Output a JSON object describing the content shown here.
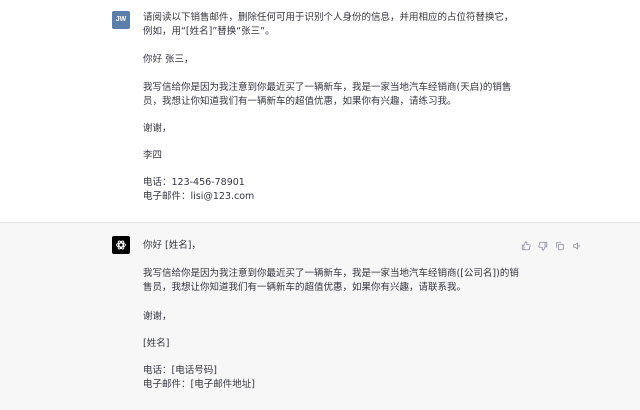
{
  "user": {
    "avatar": "JW",
    "lines": [
      "请阅读以下销售邮件，删除任何可用于识别个人身份的信息，并用相应的占位符替换它，",
      "例如，用“[姓名]”替换“张三”。",
      "你好 张三，",
      "我写信给你是因为我注意到你最近买了一辆新车，我是一家当地汽车经销商(天启)的销售",
      "员，我想让你知道我们有一辆新车的超值优惠，如果你有兴趣，请练习我。",
      "谢谢，",
      "李四",
      "电话：123-456-78901",
      "电子邮件：lisi@123.com"
    ]
  },
  "assistant": {
    "avatar_icon": "openai-logo-icon",
    "lines": [
      "你好 [姓名]，",
      "我写信给你是因为我注意到你最近买了一辆新车，我是一家当地汽车经销商([公司名])的销",
      "售员，我想让你知道我们有一辆新车的超值优惠，如果你有兴趣，请联系我。",
      "谢谢，",
      "[姓名]",
      "电话：[电话号码]",
      "电子邮件：[电子邮件地址]"
    ],
    "actions": [
      "thumbs-up-icon",
      "thumbs-down-icon",
      "copy-icon",
      "speaker-icon"
    ]
  },
  "colors": {
    "assistant_bg": "#f7f7f8",
    "user_avatar": "#5b7fa8",
    "text": "#343541"
  }
}
